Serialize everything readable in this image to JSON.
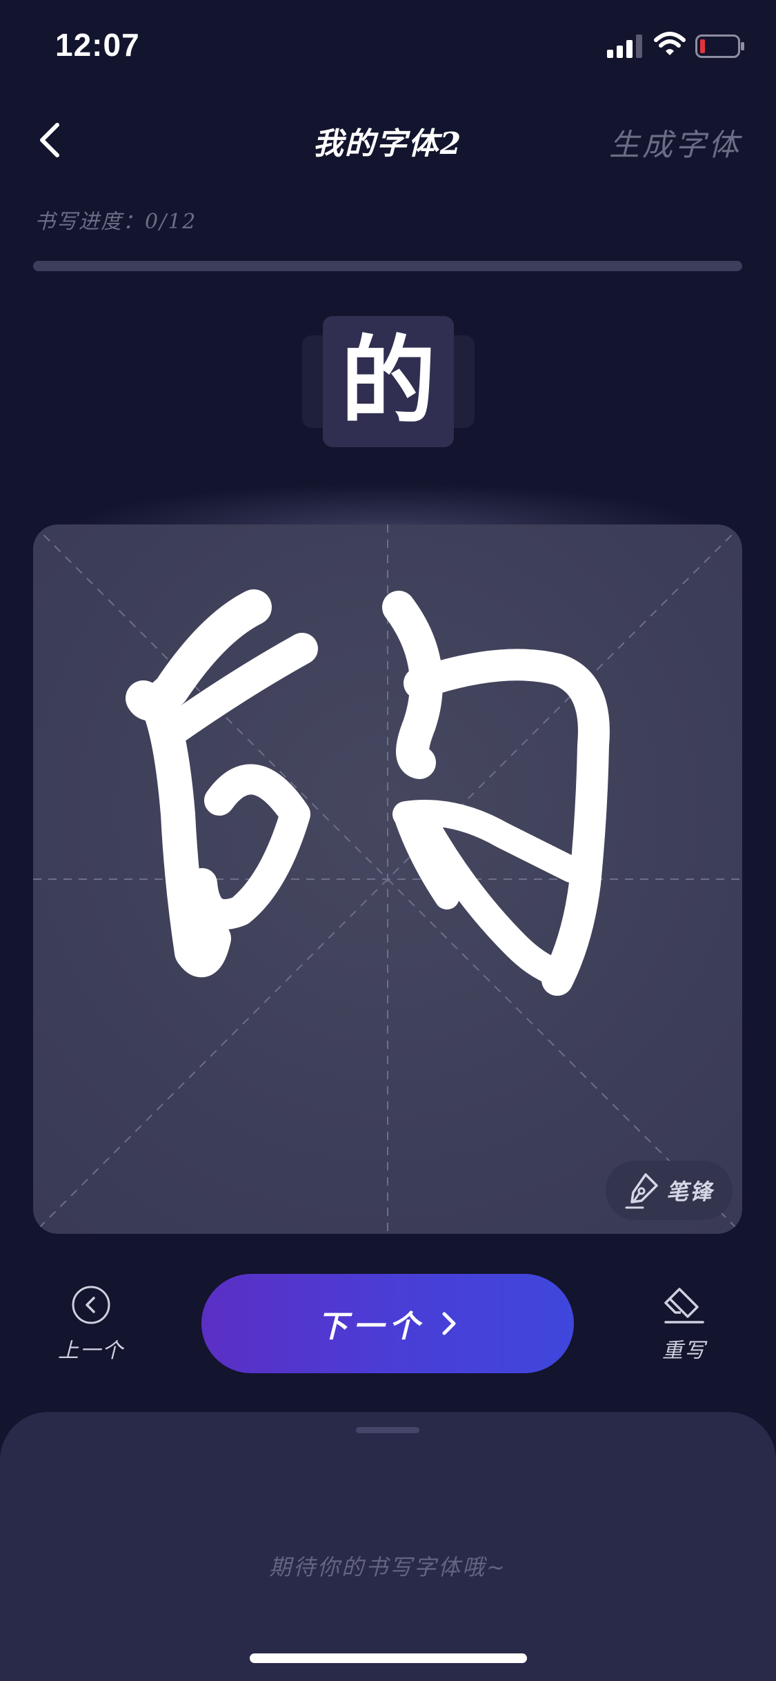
{
  "status_bar": {
    "time": "12:07",
    "icons": [
      "signal-icon",
      "wifi-icon",
      "battery-low-icon"
    ]
  },
  "nav": {
    "title": "我的字体2",
    "back_icon": "chevron-left-icon",
    "generate_label": "生成字体"
  },
  "progress": {
    "label": "书写进度：0/12",
    "completed": 0,
    "total": 12,
    "fraction": 0
  },
  "current_character": "的",
  "canvas": {
    "brush_tip_label": "笔锋",
    "brush_tip_icon": "pen-nib-icon"
  },
  "controls": {
    "prev_label": "上一个",
    "prev_icon": "chevron-left-circle-icon",
    "next_label": "下一个",
    "next_icon": "chevron-right-icon",
    "rewrite_label": "重写",
    "rewrite_icon": "eraser-icon"
  },
  "sheet": {
    "hint": "期待你的书写字体哦~"
  },
  "colors": {
    "background": "#13142d",
    "canvas": "#3d3e58",
    "accent_start": "#5b2fc4",
    "accent_end": "#3f47dc",
    "muted_text": "#6b6d86",
    "battery_low": "#e2343c"
  }
}
